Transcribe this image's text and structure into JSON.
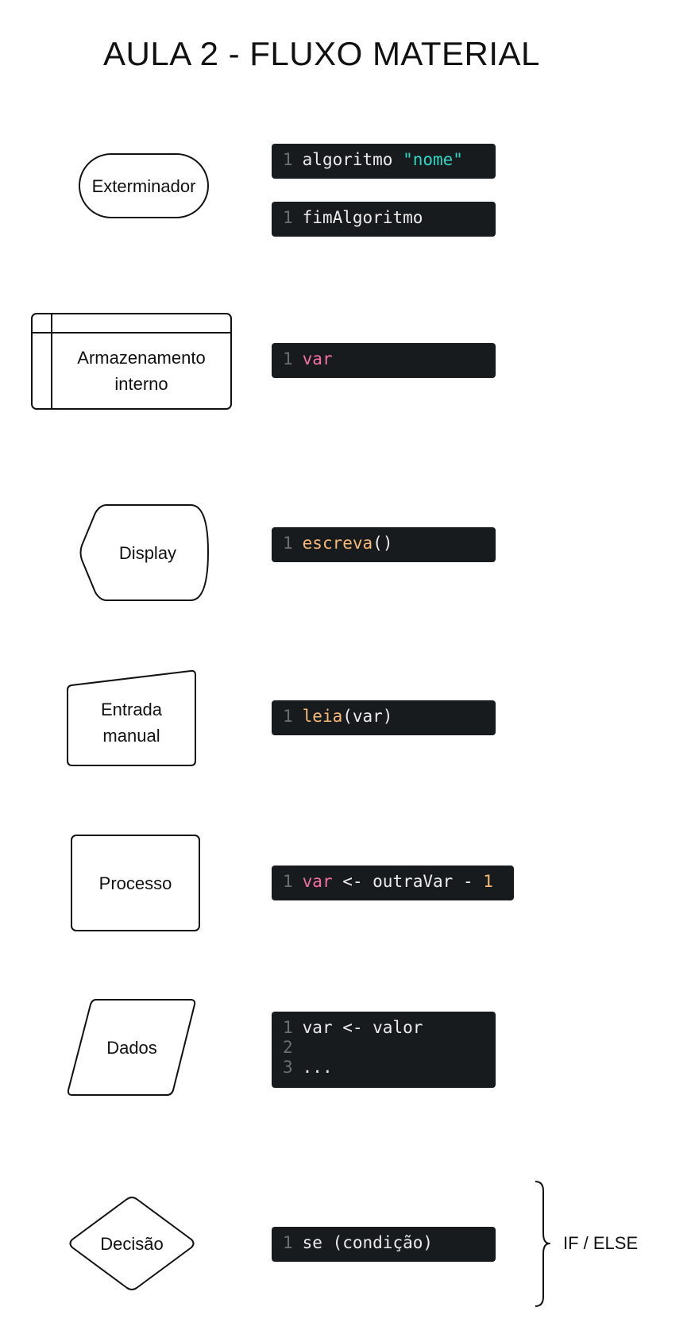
{
  "title": "AULA 2 - FLUXO MATERIAL",
  "shapes": {
    "terminator": "Exterminador",
    "storage_line1": "Armazenamento",
    "storage_line2": "interno",
    "display": "Display",
    "manual_line1": "Entrada",
    "manual_line2": "manual",
    "process": "Processo",
    "data": "Dados",
    "decision": "Decisão"
  },
  "code": {
    "terminator_start": {
      "num": "1",
      "kw": "algoritmo ",
      "str": "\"nome\""
    },
    "terminator_end": {
      "num": "1",
      "text": "fimAlgoritmo"
    },
    "storage": {
      "num": "1",
      "kw": "var"
    },
    "display": {
      "num": "1",
      "fn": "escreva",
      "rest": "()"
    },
    "manual": {
      "num": "1",
      "fn": "leia",
      "rest": "(var)"
    },
    "process": {
      "num": "1",
      "kw": "var",
      "mid": " <- outraVar - ",
      "numval": "1"
    },
    "data": [
      {
        "num": "1",
        "text": "var <- valor"
      },
      {
        "num": "2",
        "text": ""
      },
      {
        "num": "3",
        "text": "..."
      }
    ],
    "decision": {
      "num": "1",
      "text": "se (condição)"
    }
  },
  "brace_label": "IF / ELSE",
  "colors": {
    "code_bg": "#181b1e",
    "line_number": "#6b6f75",
    "string": "#2fd8c4",
    "keyword": "#f46fa8",
    "function": "#f8b877"
  }
}
